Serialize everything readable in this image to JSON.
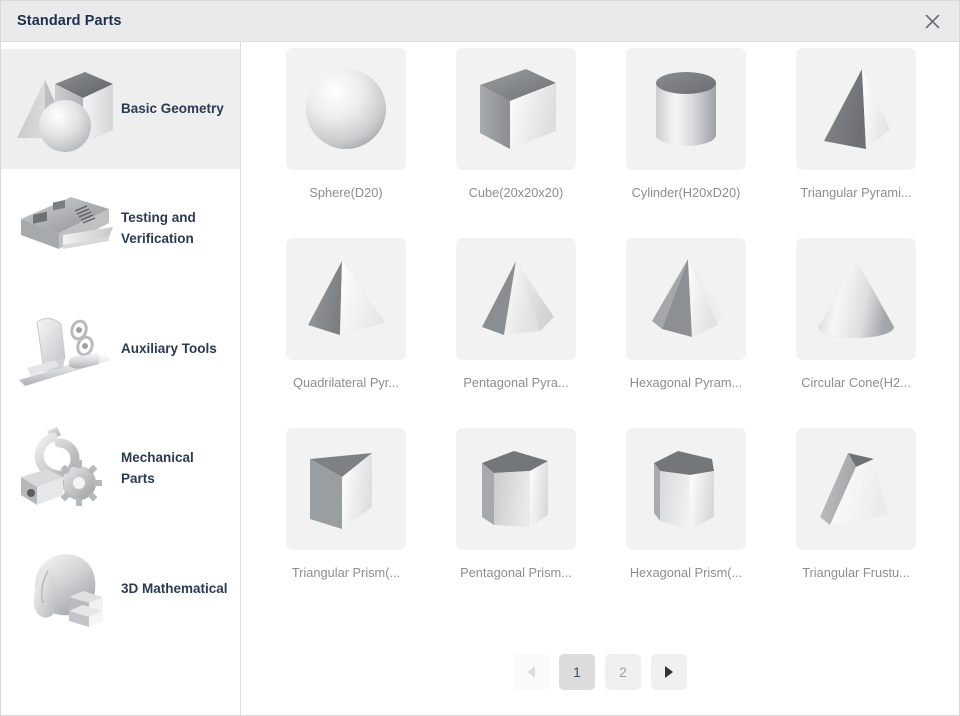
{
  "window": {
    "title": "Standard Parts",
    "close_icon": "close-icon"
  },
  "sidebar": {
    "items": [
      {
        "label": "Basic Geometry",
        "icon": "basic-geometry-icon",
        "active": true
      },
      {
        "label": "Testing and Verification",
        "icon": "testing-verification-icon",
        "active": false
      },
      {
        "label": "Auxiliary Tools",
        "icon": "auxiliary-tools-icon",
        "active": false
      },
      {
        "label": "Mechanical Parts",
        "icon": "mechanical-parts-icon",
        "active": false
      },
      {
        "label": "3D Mathematical",
        "icon": "3d-mathematical-icon",
        "active": false
      }
    ]
  },
  "parts": [
    {
      "label": "Sphere(D20)",
      "icon": "sphere-icon"
    },
    {
      "label": "Cube(20x20x20)",
      "icon": "cube-icon"
    },
    {
      "label": "Cylinder(H20xD20)",
      "icon": "cylinder-icon"
    },
    {
      "label": "Triangular Pyrami...",
      "icon": "triangular-pyramid-icon"
    },
    {
      "label": "Quadrilateral Pyr...",
      "icon": "quadrilateral-pyramid-icon"
    },
    {
      "label": "Pentagonal Pyra...",
      "icon": "pentagonal-pyramid-icon"
    },
    {
      "label": "Hexagonal Pyram...",
      "icon": "hexagonal-pyramid-icon"
    },
    {
      "label": "Circular Cone(H2...",
      "icon": "circular-cone-icon"
    },
    {
      "label": "Triangular Prism(...",
      "icon": "triangular-prism-icon"
    },
    {
      "label": "Pentagonal Prism...",
      "icon": "pentagonal-prism-icon"
    },
    {
      "label": "Hexagonal Prism(...",
      "icon": "hexagonal-prism-icon"
    },
    {
      "label": "Triangular Frustu...",
      "icon": "triangular-frustum-icon"
    }
  ],
  "pagination": {
    "prev_label": "◀",
    "next_label": "▶",
    "pages": [
      "1",
      "2"
    ],
    "current": "1",
    "prev_enabled": false,
    "next_enabled": true
  },
  "colors": {
    "titlebar_bg": "#e8eaec",
    "title_text": "#21304a",
    "sidebar_active_bg": "#eeeeee",
    "thumb_bg": "#f2f2f2",
    "label_text": "#8d8d8d",
    "pager_active_bg": "#dcdcdc"
  }
}
